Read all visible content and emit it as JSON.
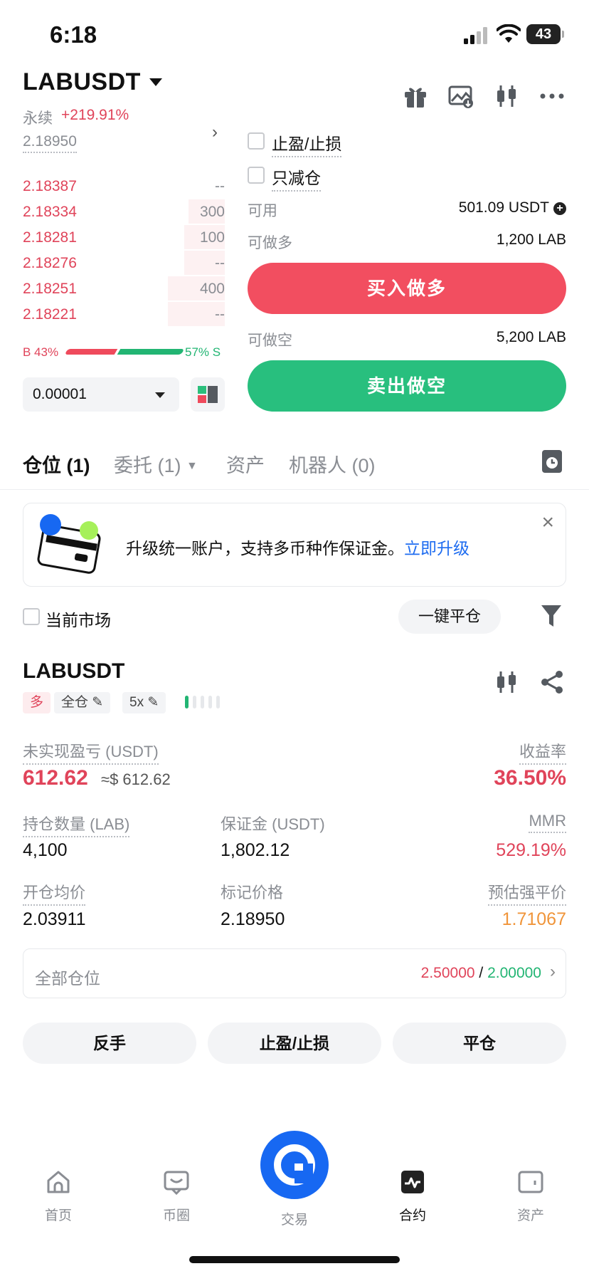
{
  "status_bar": {
    "time": "6:18",
    "battery": "43"
  },
  "header": {
    "symbol": "LABUSDT",
    "contract_type": "永续",
    "change_pct": "+219.91%",
    "icons": [
      "gift-icon",
      "image-chart-icon",
      "candlestick-icon",
      "more-icon"
    ]
  },
  "order_book": {
    "last_price": "2.18950",
    "asks": [
      {
        "price": "2.18387",
        "qty": "--",
        "depth": 0
      },
      {
        "price": "2.18334",
        "qty": "300",
        "depth": 0.18
      },
      {
        "price": "2.18281",
        "qty": "100",
        "depth": 0.2
      },
      {
        "price": "2.18276",
        "qty": "--",
        "depth": 0.2
      },
      {
        "price": "2.18251",
        "qty": "400",
        "depth": 0.28
      },
      {
        "price": "2.18221",
        "qty": "--",
        "depth": 0.28
      }
    ],
    "buy_ratio_label": "B 43%",
    "sell_ratio_label": "57% S",
    "buy_ratio": 0.43,
    "precision": "0.00001"
  },
  "order_form": {
    "tp_sl_label": "止盈/止损",
    "reduce_only_label": "只减仓",
    "available_label": "可用",
    "available_value": "501.09 USDT",
    "can_long_label": "可做多",
    "can_long_value": "1,200 LAB",
    "buy_button": "买入做多",
    "can_short_label": "可做空",
    "can_short_value": "5,200 LAB",
    "sell_button": "卖出做空"
  },
  "tabs": {
    "positions": "仓位 (1)",
    "orders": "委托 (1)",
    "assets": "资产",
    "bots": "机器人 (0)"
  },
  "banner": {
    "text": "升级统一账户，支持多币种作保证金。",
    "link": "立即升级"
  },
  "filters": {
    "current_market": "当前市场",
    "close_all": "一键平仓"
  },
  "position": {
    "symbol": "LABUSDT",
    "side_tag": "多",
    "margin_mode": "全仓",
    "leverage": "5x",
    "unrealized_pnl_label": "未实现盈亏 (USDT)",
    "unrealized_pnl": "612.62",
    "unrealized_pnl_usd": "≈$ 612.62",
    "roe_label": "收益率",
    "roe": "36.50%",
    "size_label": "持仓数量 (LAB)",
    "size": "4,100",
    "margin_label": "保证金 (USDT)",
    "margin": "1,802.12",
    "mmr_label": "MMR",
    "mmr": "529.19%",
    "entry_label": "开仓均价",
    "entry": "2.03911",
    "mark_label": "标记价格",
    "mark": "2.18950",
    "liq_label": "预估强平价",
    "liq": "1.71067",
    "all_positions_label": "全部仓位",
    "all_positions_a": "2.50000",
    "all_positions_sep": " / ",
    "all_positions_b": "2.00000",
    "actions": [
      "反手",
      "止盈/止损",
      "平仓"
    ]
  },
  "colors": {
    "red": "#e0445a",
    "green": "#22b573",
    "blue": "#1768f2"
  },
  "nav": {
    "home": "首页",
    "community": "币圈",
    "trade": "交易",
    "futures": "合约",
    "assets": "资产"
  }
}
